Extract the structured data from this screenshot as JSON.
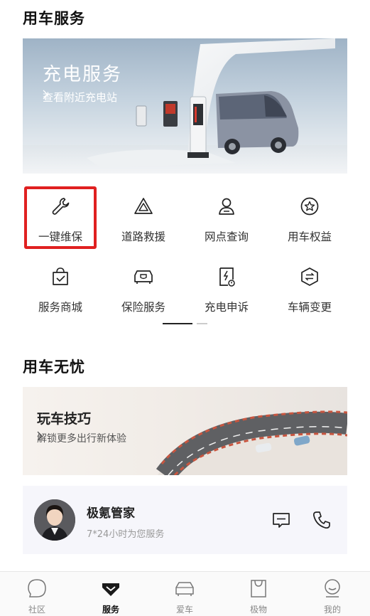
{
  "sections": {
    "vehicle_services_title": "用车服务",
    "worry_free_title": "用车无忧"
  },
  "charging_banner": {
    "title": "充电服务",
    "subtitle": "查看附近充电站"
  },
  "service_grid": [
    {
      "label": "一键维保",
      "icon": "wrench-icon"
    },
    {
      "label": "道路救援",
      "icon": "warning-triangle-icon"
    },
    {
      "label": "网点查询",
      "icon": "location-person-icon"
    },
    {
      "label": "用车权益",
      "icon": "star-badge-icon"
    },
    {
      "label": "服务商城",
      "icon": "shopping-bag-icon"
    },
    {
      "label": "保险服务",
      "icon": "car-insurance-icon"
    },
    {
      "label": "充电申诉",
      "icon": "charging-complaint-icon"
    },
    {
      "label": "车辆变更",
      "icon": "transfer-icon"
    }
  ],
  "tips_banner": {
    "title": "玩车技巧",
    "subtitle": "解锁更多出行新体验"
  },
  "butler": {
    "name": "极氪管家",
    "subtitle": "7*24小时为您服务"
  },
  "tab_bar": [
    {
      "label": "社区",
      "icon": "community-icon",
      "active": false
    },
    {
      "label": "服务",
      "icon": "service-icon",
      "active": true
    },
    {
      "label": "爱车",
      "icon": "car-icon",
      "active": false
    },
    {
      "label": "极物",
      "icon": "shop-bag-icon",
      "active": false
    },
    {
      "label": "我的",
      "icon": "profile-icon",
      "active": false
    }
  ],
  "colors": {
    "highlight": "#e02020",
    "text_primary": "#111111",
    "text_secondary": "#999999"
  }
}
